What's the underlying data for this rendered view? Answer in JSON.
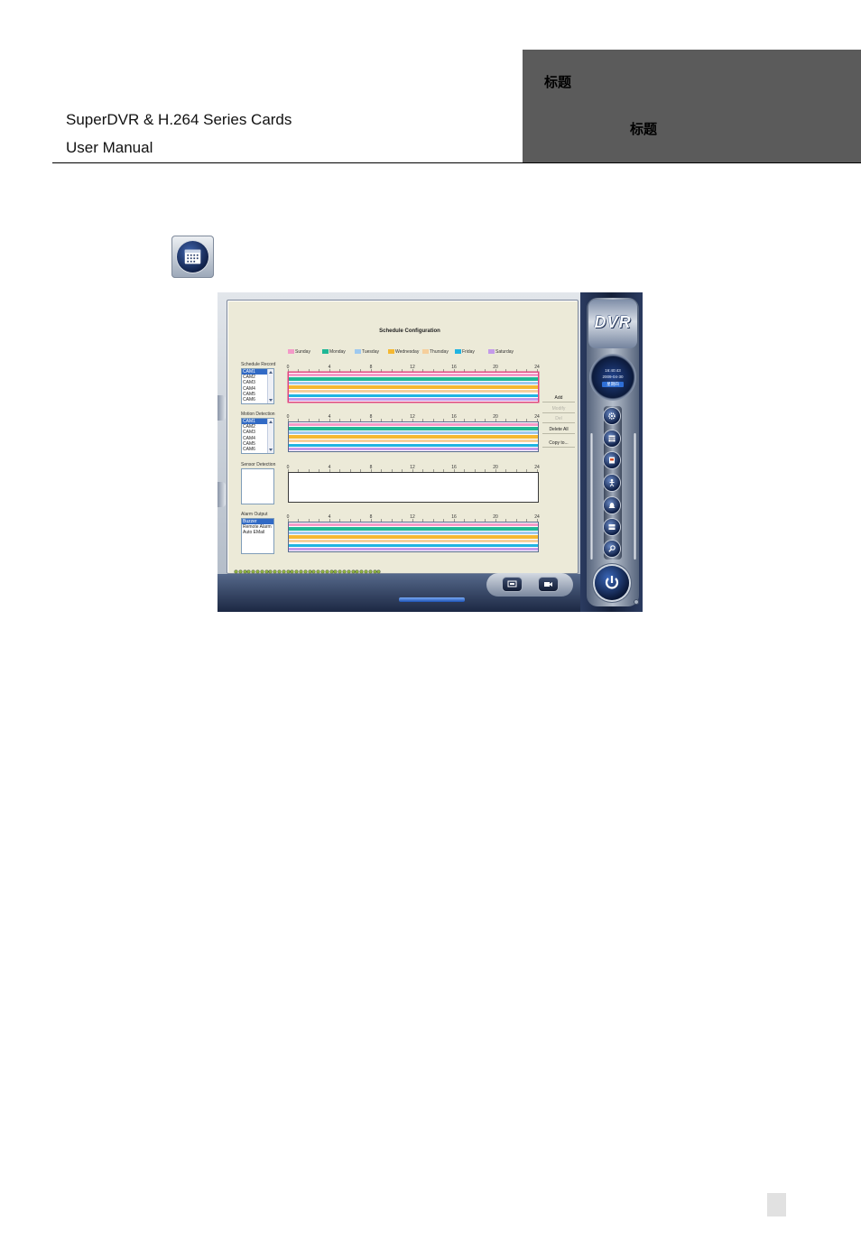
{
  "header": {
    "product_line": "SuperDVR & H.264 Series Cards",
    "document_type": "User Manual",
    "chapter_heading": "标题",
    "section_heading": "标题"
  },
  "page_icon": "calendar-icon",
  "screenshot": {
    "title": "Schedule Configuration",
    "legend": [
      {
        "label": "Sunday",
        "color": "#f49ac8"
      },
      {
        "label": "Monday",
        "color": "#1fb796"
      },
      {
        "label": "Tuesday",
        "color": "#9ec9ef"
      },
      {
        "label": "Wednesday",
        "color": "#f5b832"
      },
      {
        "label": "Thursday",
        "color": "#f6cf9c"
      },
      {
        "label": "Friday",
        "color": "#20b4e2"
      },
      {
        "label": "Saturday",
        "color": "#c49aea"
      }
    ],
    "ticks": [
      "0",
      "4",
      "8",
      "12",
      "16",
      "20",
      "24"
    ],
    "active_section": 0,
    "sections": [
      {
        "label": "Schedule Record",
        "items": [
          "CAM1",
          "CAM2",
          "CAM3",
          "CAM4",
          "CAM5",
          "CAM6"
        ],
        "selected": 0,
        "scrollable": true,
        "schedule_hours": [
          0,
          24
        ]
      },
      {
        "label": "Motion Detection",
        "items": [
          "CAM1",
          "CAM2",
          "CAM3",
          "CAM4",
          "CAM5",
          "CAM6"
        ],
        "selected": 0,
        "scrollable": true,
        "schedule_hours": [
          0,
          24
        ]
      },
      {
        "label": "Sensor Detection",
        "items": [],
        "selected": null,
        "scrollable": false,
        "schedule_hours": null
      },
      {
        "label": "Alarm Output",
        "items": [
          "Buzzer",
          "Remote Alarm",
          "Auto EMail"
        ],
        "selected": 0,
        "scrollable": false,
        "schedule_hours": [
          0,
          24
        ]
      }
    ],
    "buttons": [
      {
        "label": "Add",
        "enabled": true
      },
      {
        "label": "Modify",
        "enabled": false
      },
      {
        "label": "Del",
        "enabled": false
      },
      {
        "label": "Delete All",
        "enabled": true
      },
      {
        "label": "Copy to...",
        "enabled": true
      }
    ],
    "sidebar": {
      "logo": "DVR",
      "clock_time": "16:40:43",
      "clock_date": "2009-04-30",
      "clock_weekday": "星期四",
      "tool_icons": [
        "settings-icon",
        "schedule-icon",
        "log-icon",
        "user-icon",
        "alarm-icon",
        "storage-icon",
        "search-icon"
      ],
      "exit_icon": "exit-icon"
    }
  }
}
